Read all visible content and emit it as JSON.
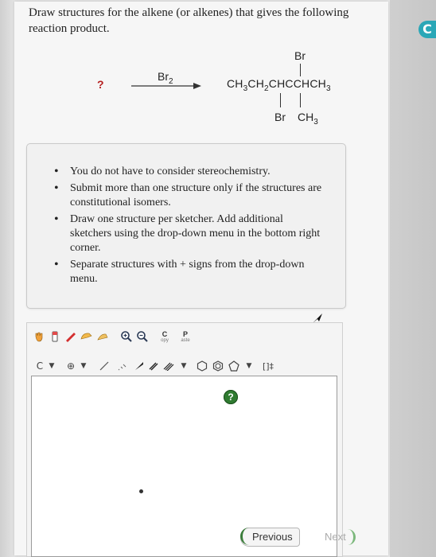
{
  "question": {
    "text": "Draw structures for the alkene (or alkenes) that gives the following reaction product."
  },
  "reaction": {
    "unknown": "?",
    "reagent_main": "Br",
    "reagent_sub": "2",
    "product_parts": [
      "CH",
      "3",
      "CH",
      "2",
      "CHCCHCH",
      "3"
    ],
    "sub_top": "Br",
    "sub_bottom_left": "Br",
    "sub_bottom_right_main": "CH",
    "sub_bottom_right_sub": "3"
  },
  "instructions": [
    "You do not have to consider stereochemistry.",
    "Submit more than one structure only if the structures are constitutional isomers.",
    "Draw one structure per sketcher. Add additional sketchers using the drop-down menu in the bottom right corner.",
    "Separate structures with + signs from the drop-down menu."
  ],
  "sketcher": {
    "toolbar1": [
      "hand-tool",
      "eraser-tool",
      "pencil-tool",
      "lasso-tool",
      "zoom-in",
      "zoom-out",
      "copy",
      "paste"
    ],
    "copy_label": "C",
    "copy_sub": "opy",
    "paste_label": "P",
    "paste_sub": "aste",
    "atom_label": "C",
    "charge_label": "⊕",
    "bracket_label": "[]‡",
    "help_label": "?"
  },
  "nav": {
    "previous": "Previous",
    "next": "Next"
  },
  "colors": {
    "accent": "#2aa7b7",
    "help_green": "#2f7b30",
    "unknown_red": "#b51f1f"
  }
}
